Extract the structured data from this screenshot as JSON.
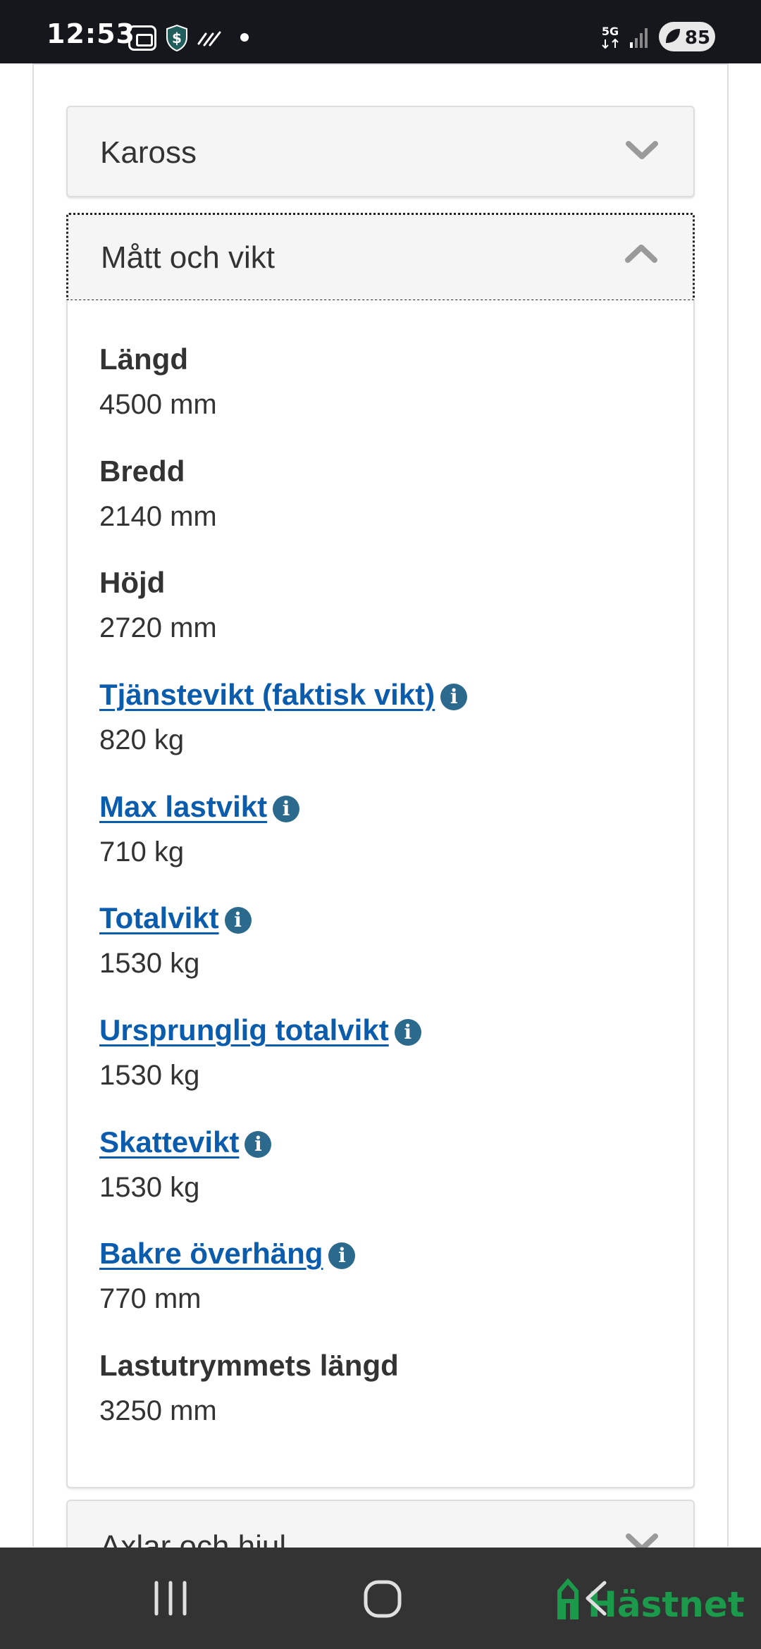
{
  "status_bar": {
    "time": "12:53",
    "network": "5G",
    "battery": "85",
    "icons": [
      "gallery-icon",
      "shield-dollar-icon",
      "wifi-calling-icon",
      "dot-icon",
      "5g-icon",
      "signal-icon",
      "battery-icon"
    ]
  },
  "accordion": {
    "kaross": {
      "title": "Kaross",
      "state": "collapsed"
    },
    "matt_och_vikt": {
      "title": "Mått och vikt",
      "state": "expanded",
      "specs": [
        {
          "label": "Längd",
          "value": "4500 mm",
          "link": false
        },
        {
          "label": "Bredd",
          "value": "2140 mm",
          "link": false
        },
        {
          "label": "Höjd",
          "value": "2720 mm",
          "link": false
        },
        {
          "label": "Tjänstevikt (faktisk vikt)",
          "value": "820 kg",
          "link": true
        },
        {
          "label": "Max lastvikt",
          "value": "710 kg",
          "link": true
        },
        {
          "label": "Totalvikt",
          "value": "1530 kg",
          "link": true
        },
        {
          "label": "Ursprunglig totalvikt",
          "value": "1530 kg",
          "link": true
        },
        {
          "label": "Skattevikt",
          "value": "1530 kg",
          "link": true
        },
        {
          "label": "Bakre överhäng",
          "value": "770 mm",
          "link": true
        },
        {
          "label": "Lastutrymmets längd",
          "value": "3250 mm",
          "link": false
        }
      ]
    },
    "axlar_och_hjul": {
      "title": "Axlar och hjul",
      "state": "collapsed"
    }
  },
  "nav_bar": {
    "icons": [
      "recent-apps-icon",
      "home-icon",
      "back-icon"
    ],
    "brand": "Hästnet"
  },
  "colors": {
    "link": "#0b5cad",
    "info_icon": "#2c6a8d",
    "panel_heading_bg": "#f5f5f5",
    "brand_green": "#1a9a4a"
  }
}
